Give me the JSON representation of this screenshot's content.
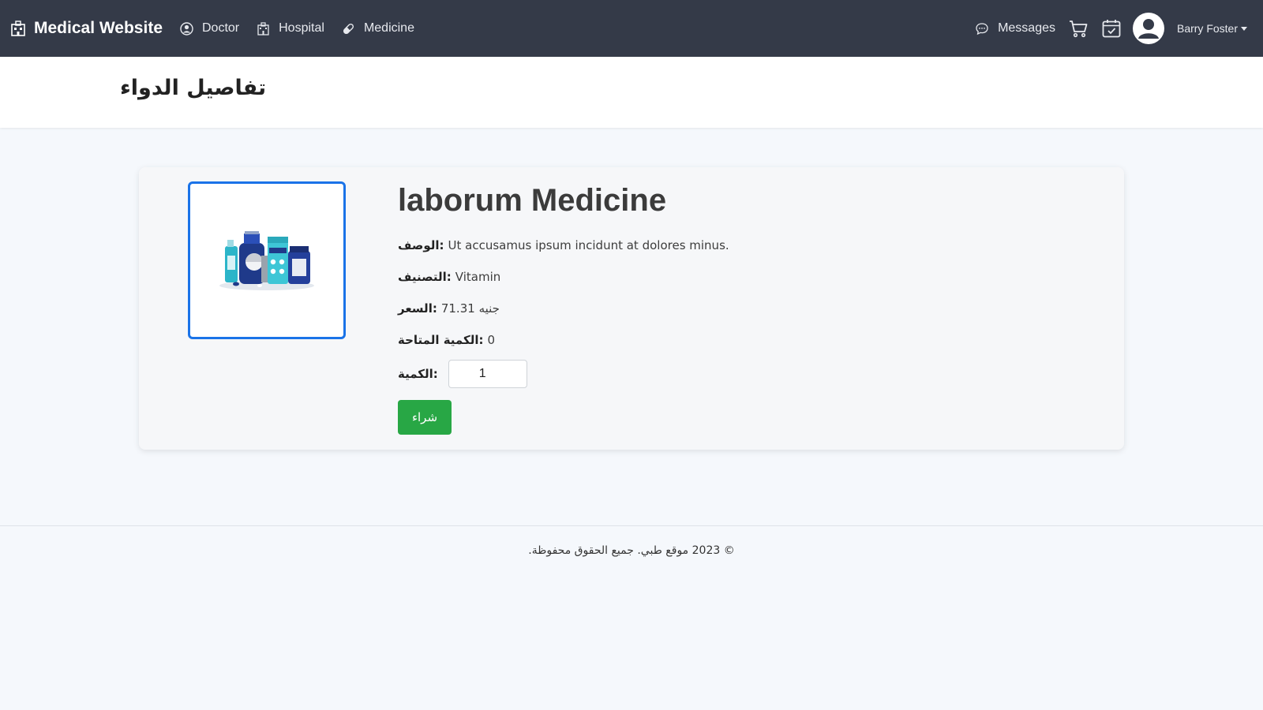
{
  "navbar": {
    "brand": "Medical Website",
    "links": [
      {
        "label": "Doctor",
        "icon": "user-circle-icon"
      },
      {
        "label": "Hospital",
        "icon": "hospital-icon"
      },
      {
        "label": "Medicine",
        "icon": "capsule-icon"
      }
    ],
    "messages_label": "Messages",
    "user_name": "Barry Foster"
  },
  "header": {
    "title": "تفاصيل الدواء"
  },
  "product": {
    "name": "laborum Medicine",
    "description_label": "الوصف:",
    "description": "Ut accusamus ipsum incidunt at dolores minus.",
    "category_label": "التصنيف:",
    "category": "Vitamin",
    "price_label": "السعر:",
    "price": "71.31 جنيه",
    "available_label": "الكمية المتاحة:",
    "available": "0",
    "quantity_label": "الكمية:",
    "quantity_value": "1",
    "buy_label": "شراء"
  },
  "footer": {
    "text": "© 2023 موقع طبي. جميع الحقوق محفوظة."
  },
  "colors": {
    "navbar": "#343a48",
    "accent_blue": "#1a73e8",
    "buy_green": "#28a745"
  }
}
